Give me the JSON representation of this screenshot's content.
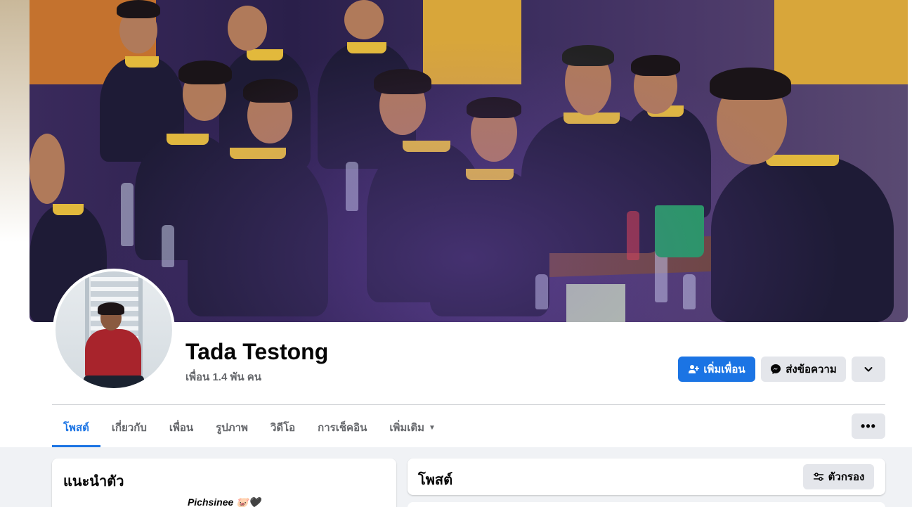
{
  "profile": {
    "name": "Tada Testong",
    "friends_text": "เพื่อน 1.4 พัน คน"
  },
  "actions": {
    "add_friend_label": "เพิ่มเพื่อน",
    "message_label": "ส่งข้อความ",
    "more_icon": "chevron-down-icon"
  },
  "tabs": [
    {
      "label": "โพสต์",
      "active": true
    },
    {
      "label": "เกี่ยวกับ",
      "active": false
    },
    {
      "label": "เพื่อน",
      "active": false
    },
    {
      "label": "รูปภาพ",
      "active": false
    },
    {
      "label": "วิดีโอ",
      "active": false
    },
    {
      "label": "การเช็คอิน",
      "active": false
    },
    {
      "label": "เพิ่มเติม",
      "active": false
    }
  ],
  "intro": {
    "title": "แนะนำตัว",
    "bio": "Pichsinee 🐷🖤"
  },
  "posts": {
    "title": "โพสต์",
    "filter_label": "ตัวกรอง"
  },
  "colors": {
    "accent": "#1b74e4",
    "secondary_button": "#e4e6eb",
    "page_background": "#f0f2f5"
  }
}
